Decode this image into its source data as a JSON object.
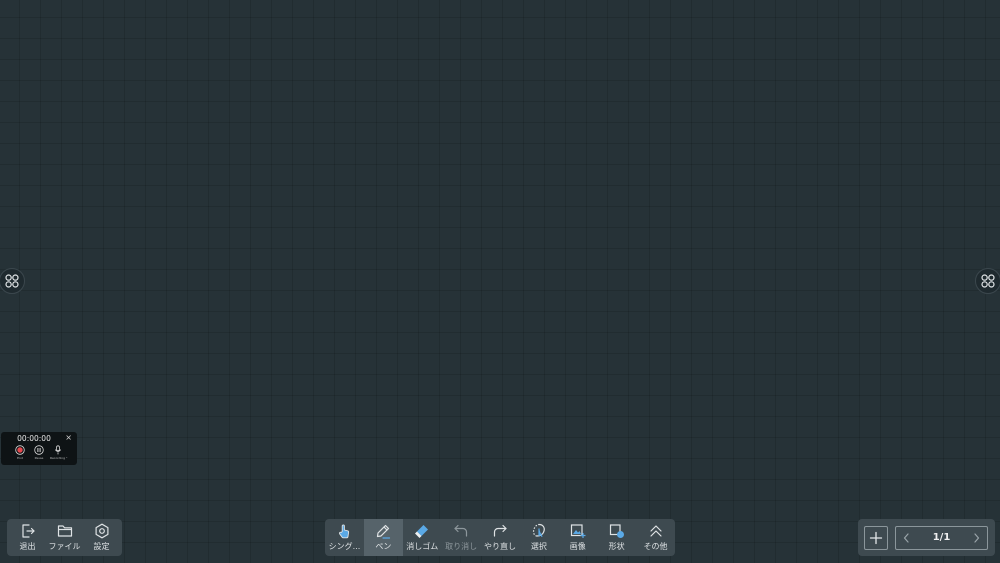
{
  "recorder": {
    "time": "00:00:00",
    "close_glyph": "×",
    "buttons": [
      {
        "label": "End",
        "icon": "record-stop-icon"
      },
      {
        "label": "Pause",
        "icon": "pause-icon"
      },
      {
        "label": "Recording \"",
        "icon": "microphone-icon"
      }
    ]
  },
  "left_toolbar": {
    "items": [
      {
        "label": "退出",
        "icon": "exit-icon"
      },
      {
        "label": "ファイル",
        "icon": "folder-icon"
      },
      {
        "label": "設定",
        "icon": "gear-icon"
      }
    ]
  },
  "center_toolbar": {
    "items": [
      {
        "label": "シング...",
        "icon": "touch-hand-icon"
      },
      {
        "label": "ペン",
        "icon": "pen-icon",
        "active": true
      },
      {
        "label": "消しゴム",
        "icon": "eraser-icon"
      },
      {
        "label": "取り消し",
        "icon": "undo-icon",
        "disabled": true
      },
      {
        "label": "やり直し",
        "icon": "redo-icon"
      },
      {
        "label": "選択",
        "icon": "lasso-select-icon"
      },
      {
        "label": "画像",
        "icon": "image-icon"
      },
      {
        "label": "形状",
        "icon": "shape-icon"
      },
      {
        "label": "その他",
        "icon": "chevron-up-double-icon"
      }
    ]
  },
  "pager": {
    "current": "1/1",
    "add_icon": "plus-icon",
    "prev_icon": "chevron-left-icon",
    "next_icon": "chevron-right-icon"
  },
  "colors": {
    "canvas": "#263237",
    "toolbar": "#3e4a50",
    "accent": "#5aa9e6",
    "record_red": "#e5484d"
  }
}
